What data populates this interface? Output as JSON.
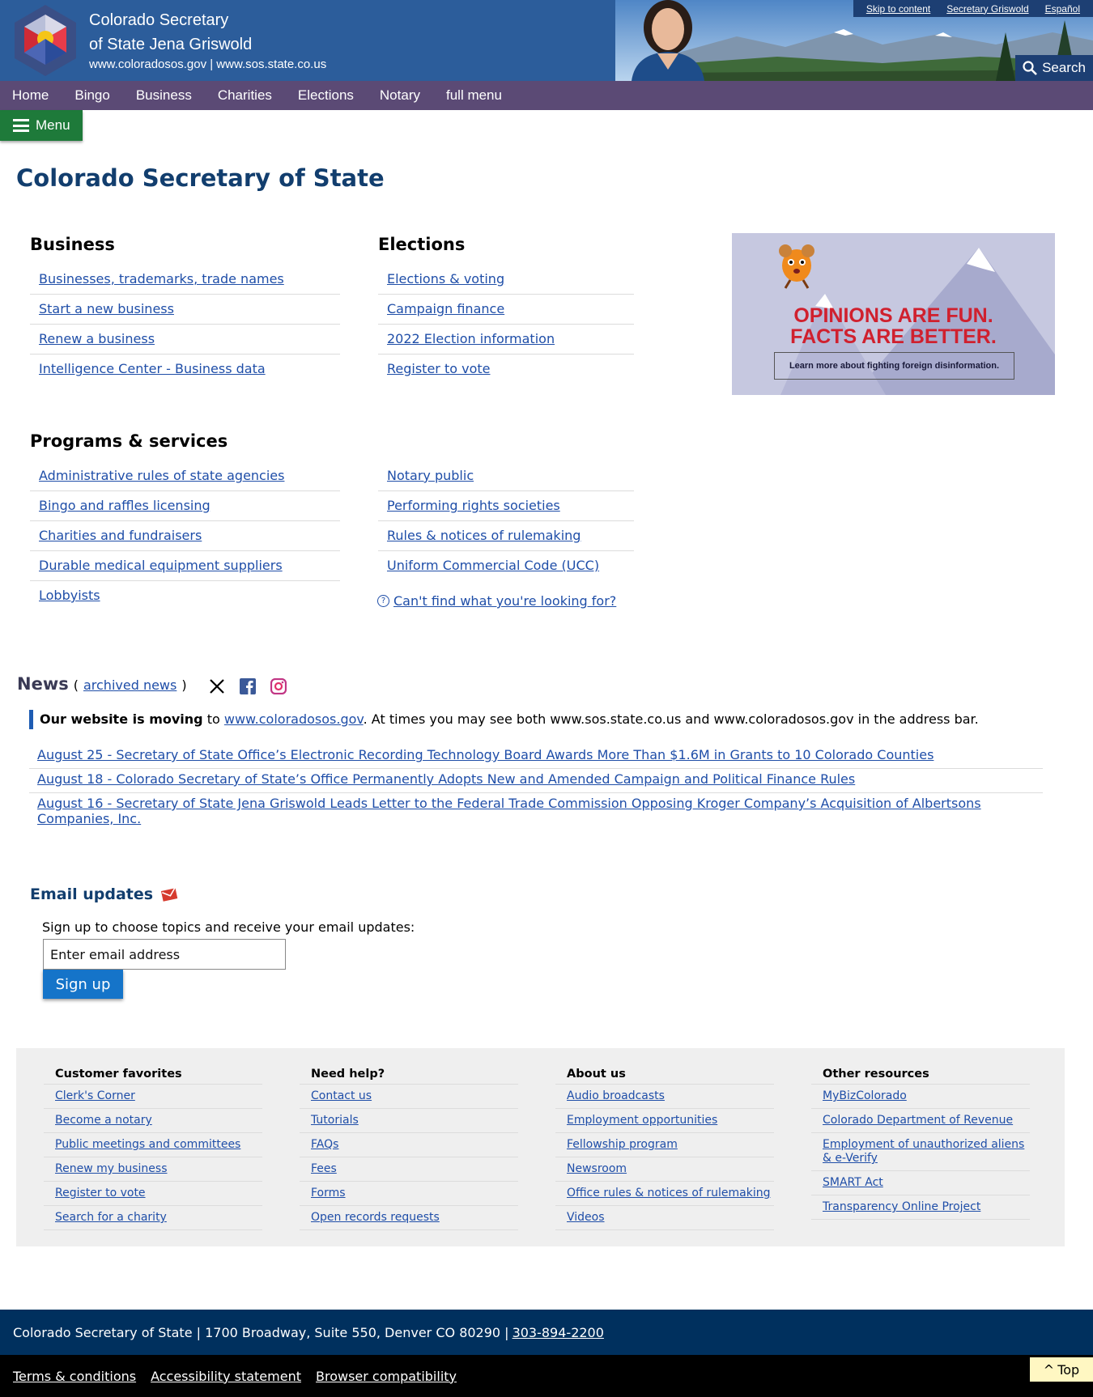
{
  "header": {
    "title_line1": "Colorado Secretary",
    "title_line2": "of State Jena Griswold",
    "urls": "www.coloradosos.gov | www.sos.state.co.us",
    "skip_link": "Skip to content",
    "secretary_link": "Secretary Griswold",
    "espanol_link": "Español",
    "search_label": "Search"
  },
  "nav": {
    "items": [
      "Home",
      "Bingo",
      "Business",
      "Charities",
      "Elections",
      "Notary",
      "full menu"
    ],
    "menu_label": "Menu"
  },
  "page_title": "Colorado Secretary of State",
  "business": {
    "heading": "Business",
    "links": [
      "Businesses, trademarks, trade names",
      "Start a new business",
      "Renew a business",
      "Intelligence Center - Business data"
    ]
  },
  "elections": {
    "heading": "Elections",
    "links": [
      "Elections & voting",
      "Campaign finance",
      "2022 Election information",
      "Register to vote"
    ]
  },
  "promo": {
    "line1": "OPINIONS ARE FUN.",
    "line2": "FACTS ARE BETTER.",
    "cta": "Learn more about fighting foreign disinformation."
  },
  "programs": {
    "heading": "Programs & services",
    "left": [
      "Administrative rules of state agencies",
      "Bingo and raffles licensing",
      "Charities and fundraisers",
      "Durable medical equipment suppliers",
      "Lobbyists"
    ],
    "right": [
      "Notary public",
      "Performing rights societies",
      "Rules & notices of rulemaking",
      "Uniform Commercial Code (UCC)"
    ],
    "cant_find": "Can't find what you're looking for?"
  },
  "news": {
    "title": "News",
    "paren_open": "(",
    "archived": "archived news",
    "paren_close": ")",
    "notice_bold": "Our website is moving",
    "notice_to": "to",
    "notice_link": "www.coloradosos.gov",
    "notice_rest": ". At times you may see both www.sos.state.co.us and www.coloradosos.gov in the address bar.",
    "items": [
      "August 25 - Secretary of State Office’s Electronic Recording Technology Board Awards More Than $1.6M in Grants to 10 Colorado Counties",
      "August 18 - Colorado Secretary of State’s Office Permanently Adopts New and Amended Campaign and Political Finance Rules",
      "August 16 - Secretary of State Jena Griswold Leads Letter to the Federal Trade Commission Opposing Kroger Company’s Acquisition of Albertsons Companies, Inc."
    ]
  },
  "email": {
    "heading": "Email updates",
    "text": "Sign up to choose topics and receive your email updates:",
    "placeholder": "Enter email address",
    "button": "Sign up"
  },
  "footer": {
    "columns": [
      {
        "heading": "Customer favorites",
        "links": [
          "Clerk's Corner",
          "Become a notary",
          "Public meetings and committees",
          "Renew my business",
          "Register to vote",
          "Search for a charity"
        ]
      },
      {
        "heading": "Need help?",
        "links": [
          "Contact us",
          "Tutorials",
          "FAQs",
          "Fees",
          "Forms",
          "Open records requests"
        ]
      },
      {
        "heading": "About us",
        "links": [
          "Audio broadcasts",
          "Employment opportunities",
          "Fellowship program",
          "Newsroom",
          "Office rules & notices of rulemaking",
          "Videos"
        ]
      },
      {
        "heading": "Other resources",
        "links": [
          "MyBizColorado",
          "Colorado Department of Revenue",
          "Employment of unauthorized aliens & e-Verify",
          "SMART Act",
          "Transparency Online Project"
        ]
      }
    ],
    "address": "Colorado Secretary of State | 1700 Broadway, Suite 550, Denver CO 80290 |",
    "phone": "303-894-2200",
    "bottom_links": [
      "Terms & conditions",
      "Accessibility statement",
      "Browser compatibility"
    ],
    "top_label": "Top"
  },
  "colors": {
    "header_blue": "#2c5d9b",
    "nav_purple": "#5b4a75",
    "menu_green": "#1e7a3a",
    "title_navy": "#123e6e",
    "link_blue": "#1f4ea8",
    "signup_blue": "#1574c9",
    "address_navy": "#00305e"
  }
}
